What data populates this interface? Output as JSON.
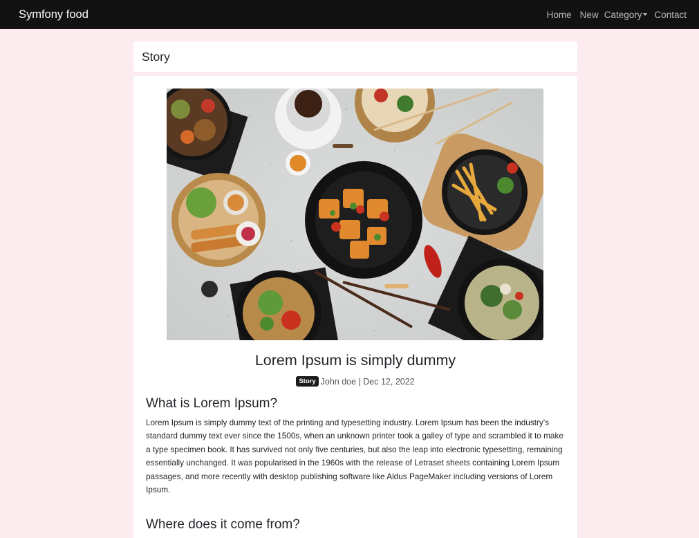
{
  "navbar": {
    "brand": "Symfony food",
    "links": {
      "home": "Home",
      "new": "New",
      "category": "Category",
      "contact": "Contact"
    }
  },
  "header": {
    "title": "Story"
  },
  "article": {
    "title": "Lorem Ipsum is simply dummy",
    "badge": "Story",
    "author_date": "John doe | Dec 12, 2022",
    "section1_heading": "What is Lorem Ipsum?",
    "section1_body": "Lorem Ipsum is simply dummy text of the printing and typesetting industry. Lorem Ipsum has been the industry's standard dummy text ever since the 1500s, when an unknown printer took a galley of type and scrambled it to make a type specimen book. It has survived not only five centuries, but also the leap into electronic typesetting, remaining essentially unchanged. It was popularised in the 1960s with the release of Letraset sheets containing Lorem Ipsum passages, and more recently with desktop publishing software like Aldus PageMaker including versions of Lorem Ipsum.",
    "section2_heading": "Where does it come from?"
  },
  "colors": {
    "page_background": "#fdecef",
    "navbar_background": "#131213",
    "badge_background": "#1b1b1b"
  }
}
